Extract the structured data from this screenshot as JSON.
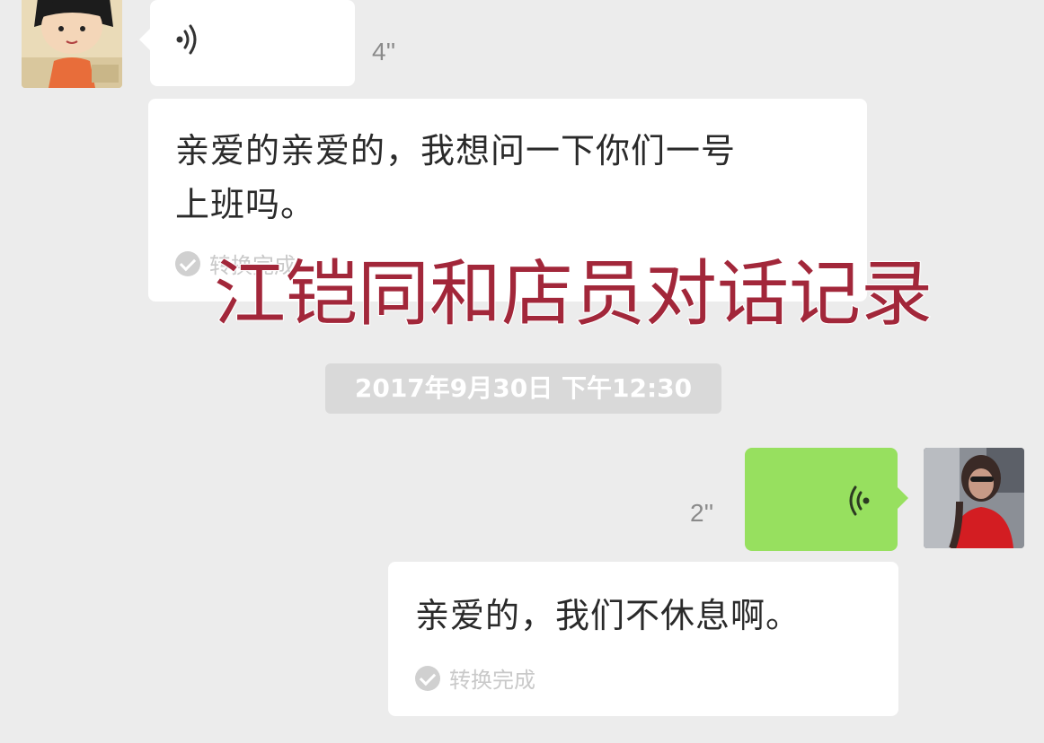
{
  "overlay_title": "江铠同和店员对话记录",
  "messages": {
    "left_voice": {
      "duration": "4''"
    },
    "left_text": {
      "line1": "亲爱的亲爱的，我想问一下你们一号",
      "line2": "上班吗。",
      "status": "转换完成"
    },
    "timestamp": "2017年9月30日 下午12:30",
    "right_voice": {
      "duration": "2''"
    },
    "right_text": {
      "text": "亲爱的，我们不休息啊。",
      "status": "转换完成"
    }
  },
  "icons": {
    "left_avatar": "cartoon-girl-avatar",
    "right_avatar": "woman-photo-avatar",
    "voice": "voice-wave-icon",
    "check": "check-circle-icon"
  },
  "colors": {
    "background": "#ececec",
    "bubble_white": "#ffffff",
    "bubble_green": "#97e05f",
    "title_red": "#a2273a",
    "timestamp_bg": "#d9d9d9"
  }
}
